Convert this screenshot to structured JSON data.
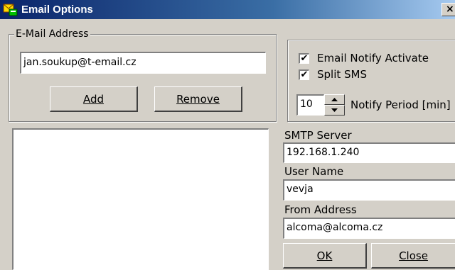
{
  "window": {
    "title": "Email Options",
    "close_label": "×"
  },
  "email_group": {
    "legend": "E-Mail Address",
    "input_value": "jan.soukup@t-email.cz",
    "add_label": "Add",
    "remove_label": "Remove"
  },
  "notify": {
    "email_notify_label": "Email Notify Activate",
    "email_notify_checked": true,
    "split_sms_label": "Split SMS",
    "split_sms_checked": true,
    "period_value": "10",
    "period_label": "Notify Period [min]"
  },
  "smtp": {
    "server_label": "SMTP Server",
    "server_value": "192.168.1.240",
    "user_label": "User Name",
    "user_value": "vevja",
    "from_label": "From Address",
    "from_value": "alcoma@alcoma.cz"
  },
  "buttons": {
    "ok_label": "OK",
    "close_label": "Close"
  },
  "icons": {
    "title_icon": "email-options-icon",
    "check_icon": "checkmark-icon"
  },
  "colors": {
    "title_bar_start": "#0a246a",
    "title_bar_end": "#a6caf0",
    "face": "#d4d0c8"
  }
}
